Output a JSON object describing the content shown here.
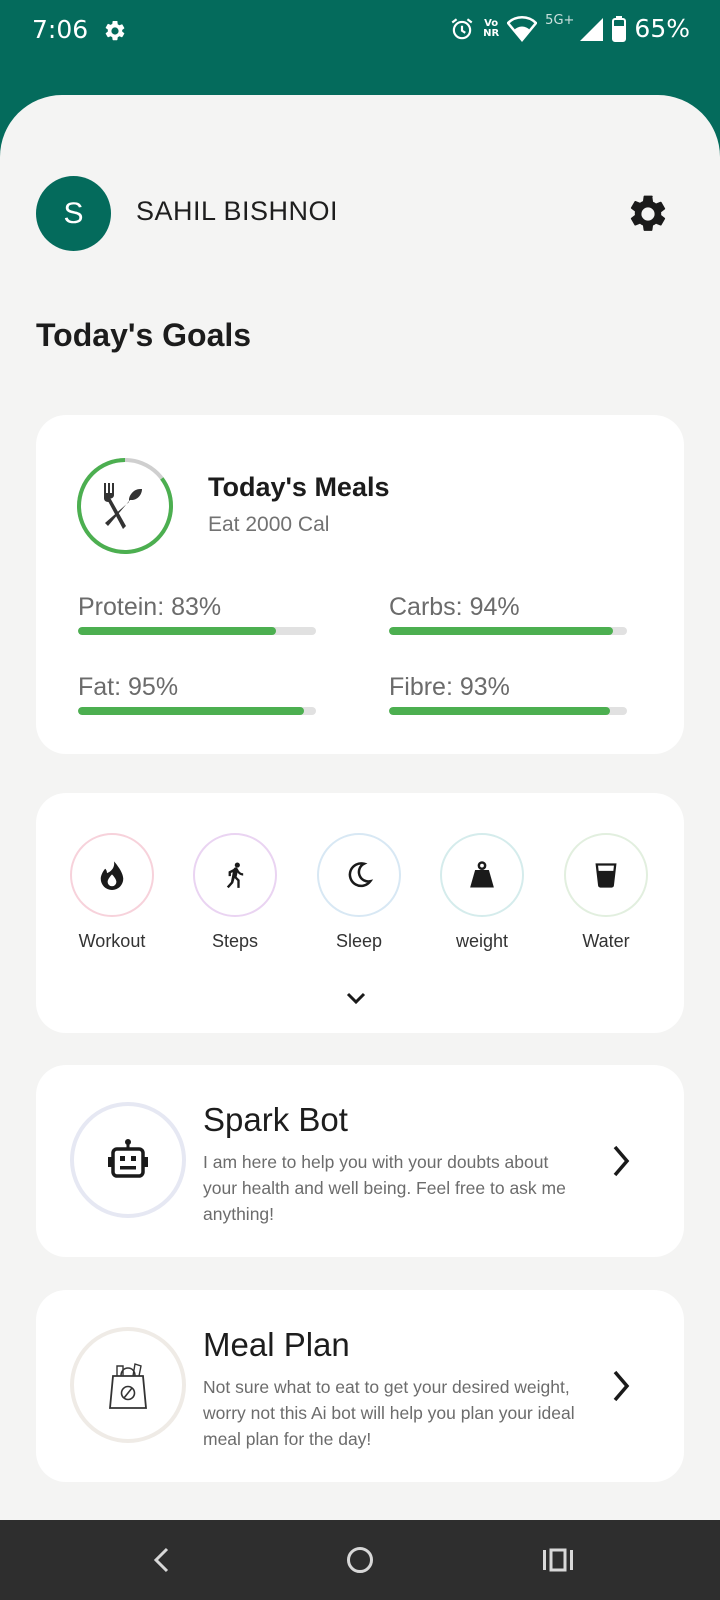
{
  "status_bar": {
    "time": "7:06",
    "network": "5G+",
    "vo_label": "Vo",
    "nr_label": "NR",
    "battery": "65%"
  },
  "header": {
    "avatar_initial": "S",
    "user_name": "SAHIL BISHNOI"
  },
  "page": {
    "section_title": "Today's Goals"
  },
  "meals": {
    "title": "Today's Meals",
    "subtitle": "Eat 2000 Cal",
    "macros": [
      {
        "label": "Protein: 83%",
        "percent": 83
      },
      {
        "label": "Carbs: 94%",
        "percent": 94
      },
      {
        "label": "Fat: 95%",
        "percent": 95
      },
      {
        "label": "Fibre: 93%",
        "percent": 93
      }
    ]
  },
  "trackers": [
    {
      "label": "Workout",
      "icon": "flame-icon",
      "color": "#f7d2db"
    },
    {
      "label": "Steps",
      "icon": "walking-icon",
      "color": "#ead4f2"
    },
    {
      "label": "Sleep",
      "icon": "moon-icon",
      "color": "#d8e8f4"
    },
    {
      "label": "weight",
      "icon": "weight-icon",
      "color": "#d5ecec"
    },
    {
      "label": "Water",
      "icon": "glass-icon",
      "color": "#e2efdf"
    }
  ],
  "features": [
    {
      "title": "Spark Bot",
      "description": "I am here to help you with your doubts about your health and well being. Feel free to ask me anything!",
      "icon": "robot-icon"
    },
    {
      "title": "Meal Plan",
      "description": "Not sure what to eat to get your desired weight, worry not this Ai bot will help you plan your ideal meal plan for the day!",
      "icon": "grocery-bag-icon"
    }
  ],
  "colors": {
    "primary": "#046b5c",
    "progress": "#4caf50",
    "background": "#f4f4f3"
  }
}
